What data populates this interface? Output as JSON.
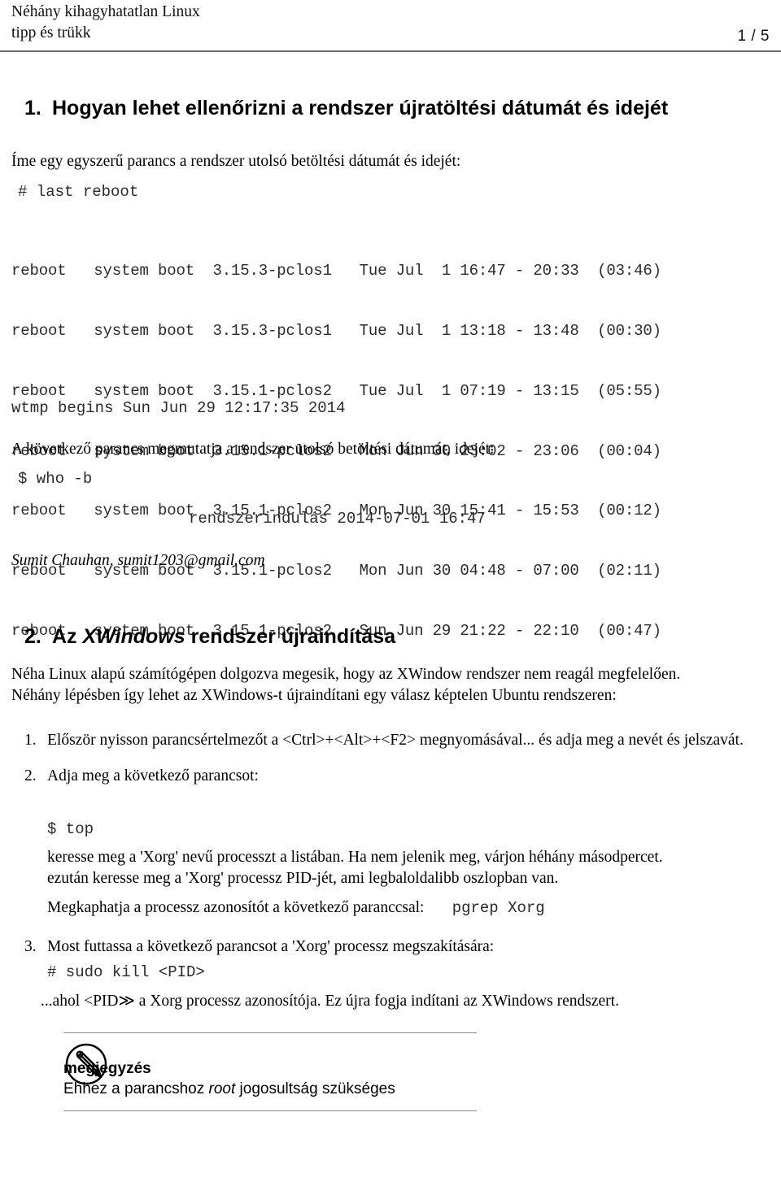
{
  "header": {
    "title_line1": "Néhány kihagyhatatlan Linux",
    "title_line2": "tipp és trükk",
    "page_number": "1 / 5"
  },
  "section1": {
    "number": "1.",
    "heading": "Hogyan lehet ellenőrizni a rendszer újratöltési dátumát és idejét",
    "intro": "Íme egy egyszerű parancs a rendszer utolsó betöltési dátumát és idejét:",
    "command": "# last reboot",
    "terminal_lines": [
      "reboot   system boot  3.15.3-pclos1   Tue Jul  1 16:47 - 20:33  (03:46)",
      "reboot   system boot  3.15.3-pclos1   Tue Jul  1 13:18 - 13:48  (00:30)",
      "reboot   system boot  3.15.1-pclos2   Tue Jul  1 07:19 - 13:15  (05:55)",
      "reboot   system boot  3.15.1-pclos2   Mon Jun 30 23:02 - 23:06  (00:04)",
      "reboot   system boot  3.15.1-pclos2   Mon Jun 30 15:41 - 15:53  (00:12)",
      "reboot   system boot  3.15.1-pclos2   Mon Jun 30 04:48 - 07:00  (02:11)",
      "reboot   system boot  3.15.1-pclos2   Sun Jun 29 21:22 - 22:10  (00:47)"
    ],
    "wtmp_line": "wtmp begins Sun Jun 29 12:17:35 2014",
    "second_intro": "A következő parancs megmutatja a rendszer utolsó betöltési dátumát, idejét:",
    "second_command": "$ who -b",
    "second_output": "rendszerindulás 2014-07-01 16:47",
    "byline": "Sumit Chauhan, sumit1203@gmail.com"
  },
  "section2": {
    "number": "2.",
    "heading_prefix": "Az ",
    "heading_emphasis": "XWindows",
    "heading_suffix": " rendszer újraindítása",
    "paragraph_line1": "Néha Linux alapú számítógépen dolgozva megesik, hogy az XWindow rendszer nem reagál megfelelően.",
    "paragraph_line2": "Néhány lépésben így lehet az XWindows-t újraindítani egy válasz képtelen Ubuntu rendszeren:",
    "steps": [
      {
        "marker": "1.",
        "text": "Először nyisson parancsértelmezőt a <Ctrl>+<Alt>+<F2> megnyomásával... és adja meg a nevét és jelszavát."
      },
      {
        "marker": "2.",
        "text": "Adja meg a következő parancsot:",
        "command": "$ top",
        "follow_line1": "keresse meg a 'Xorg' nevű processzt a listában.  Ha nem jelenik meg, várjon héhány másodpercet.",
        "follow_line2": "ezután keresse meg a 'Xorg' processz PID-jét, ami legbaloldalibb oszlopban van.",
        "follow_line3_prefix": "Megkaphatja a processz azonosítót a következő paranccsal:",
        "follow_line3_mono": "pgrep Xorg"
      },
      {
        "marker": "3.",
        "text": "Most futtassa a következő parancsot a 'Xorg' processz megszakítására:",
        "command": "# sudo kill <PID>",
        "follow_line1": "...ahol <PID≫ a Xorg processz azonosítója. Ez újra fogja indítani az XWindows rendszert."
      }
    ]
  },
  "note": {
    "icon": "pencil-icon",
    "label": "megjegyzés",
    "text_prefix": "Ehhez a parancshoz ",
    "text_emphasis": "root",
    "text_suffix": " jogosultság szükséges"
  }
}
